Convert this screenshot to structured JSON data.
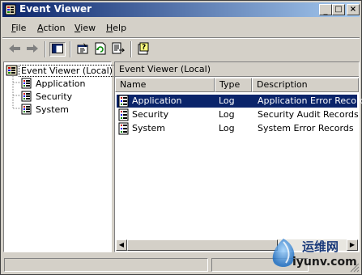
{
  "window": {
    "title": "Event Viewer"
  },
  "titlebar_buttons": {
    "minimize": "_",
    "maximize": "□",
    "close": "×"
  },
  "menu": {
    "items": [
      {
        "label": "File",
        "u": "F",
        "rest": "ile"
      },
      {
        "label": "Action",
        "u": "A",
        "rest": "ction"
      },
      {
        "label": "View",
        "u": "V",
        "rest": "iew"
      },
      {
        "label": "Help",
        "u": "H",
        "rest": "elp"
      }
    ]
  },
  "toolbar": {
    "icons": [
      "back-arrow-icon",
      "forward-arrow-icon",
      "show-hide-tree-icon",
      "properties-icon",
      "refresh-icon",
      "export-list-icon",
      "help-icon"
    ]
  },
  "tree": {
    "root": "Event Viewer (Local)",
    "children": [
      "Application",
      "Security",
      "System"
    ]
  },
  "right_pane": {
    "header": "Event Viewer (Local)",
    "columns": [
      "Name",
      "Type",
      "Description"
    ],
    "rows": [
      {
        "name": "Application",
        "type": "Log",
        "description": "Application Error Records",
        "selected": true
      },
      {
        "name": "Security",
        "type": "Log",
        "description": "Security Audit Records",
        "selected": false
      },
      {
        "name": "System",
        "type": "Log",
        "description": "System Error Records",
        "selected": false
      }
    ]
  },
  "scrollbar": {
    "left_arrow": "◀",
    "right_arrow": "▶"
  },
  "watermark": {
    "cn": "运维网",
    "url": "iyunv.com"
  },
  "colors": {
    "selection": "#0a246a",
    "title_gradient_start": "#0a246a",
    "title_gradient_end": "#a6caf0",
    "face": "#d4d0c8"
  }
}
